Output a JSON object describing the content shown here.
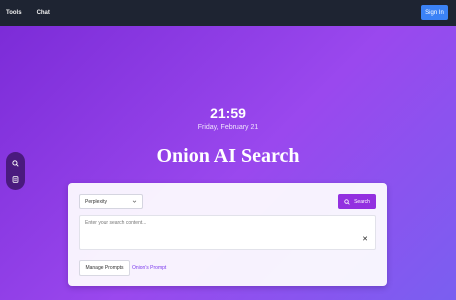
{
  "nav": {
    "tools_label": "Tools",
    "chat_label": "Chat",
    "signin_label": "Sign In"
  },
  "hero": {
    "time": "21:59",
    "date": "Friday, February 21",
    "title": "Onion AI Search"
  },
  "sidebar": {
    "icons": [
      "search-icon",
      "document-icon"
    ]
  },
  "search": {
    "model_selected": "Perplexity",
    "button_label": "Search",
    "placeholder": "Enter your search content...",
    "manage_label": "Manage Prompts",
    "onion_label": "Onion's Prompt"
  },
  "colors": {
    "accent": "#9330e0",
    "signin": "#3b82f6",
    "topbar": "#1e2432"
  }
}
